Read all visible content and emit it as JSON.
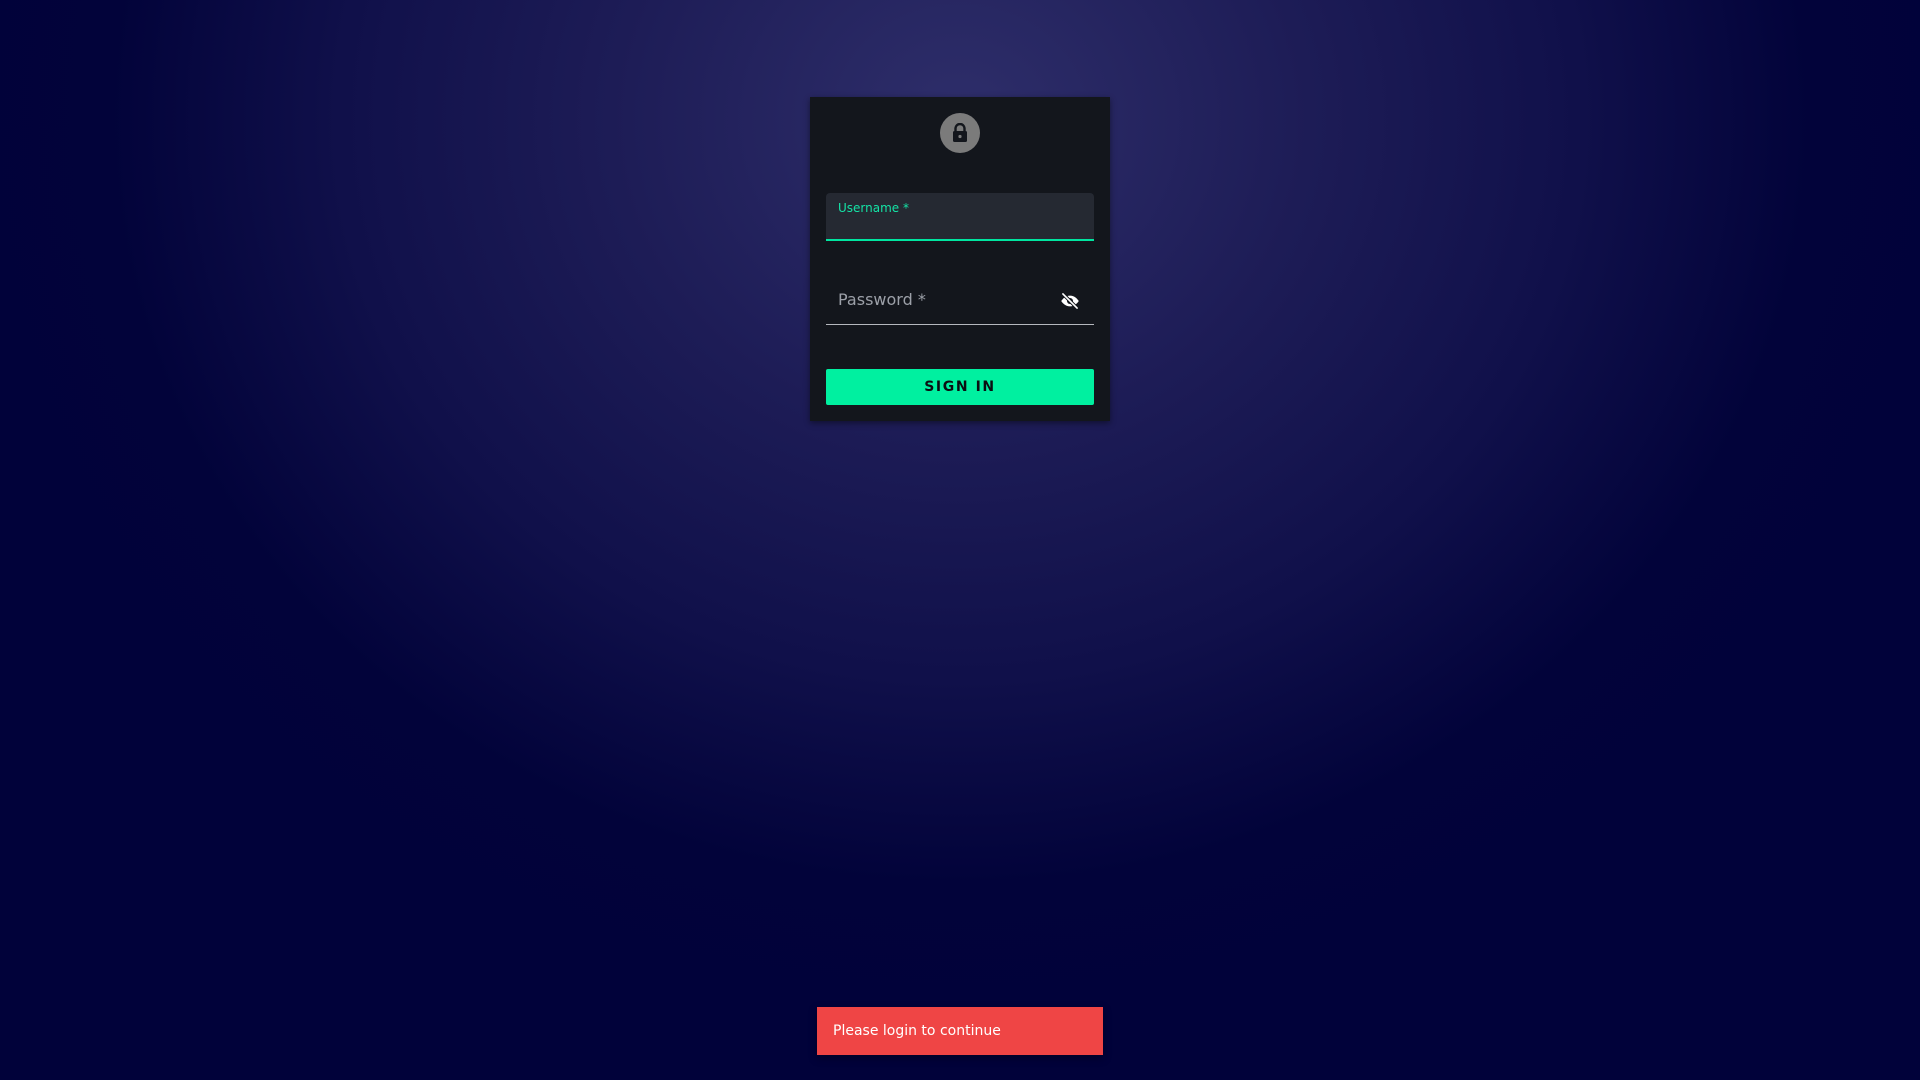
{
  "login": {
    "username_label": "Username *",
    "username_value": "",
    "password_label": "Password *",
    "password_value": "",
    "signin_label": "SIGN IN",
    "icons": {
      "avatar": "lock-icon",
      "password_toggle": "visibility-off-icon"
    }
  },
  "notification": {
    "message": "Please login to continue"
  },
  "colors": {
    "accent": "#00f0a0",
    "card_background": "#13161c",
    "error": "#ef4545",
    "page_background": "#1d1c56"
  }
}
